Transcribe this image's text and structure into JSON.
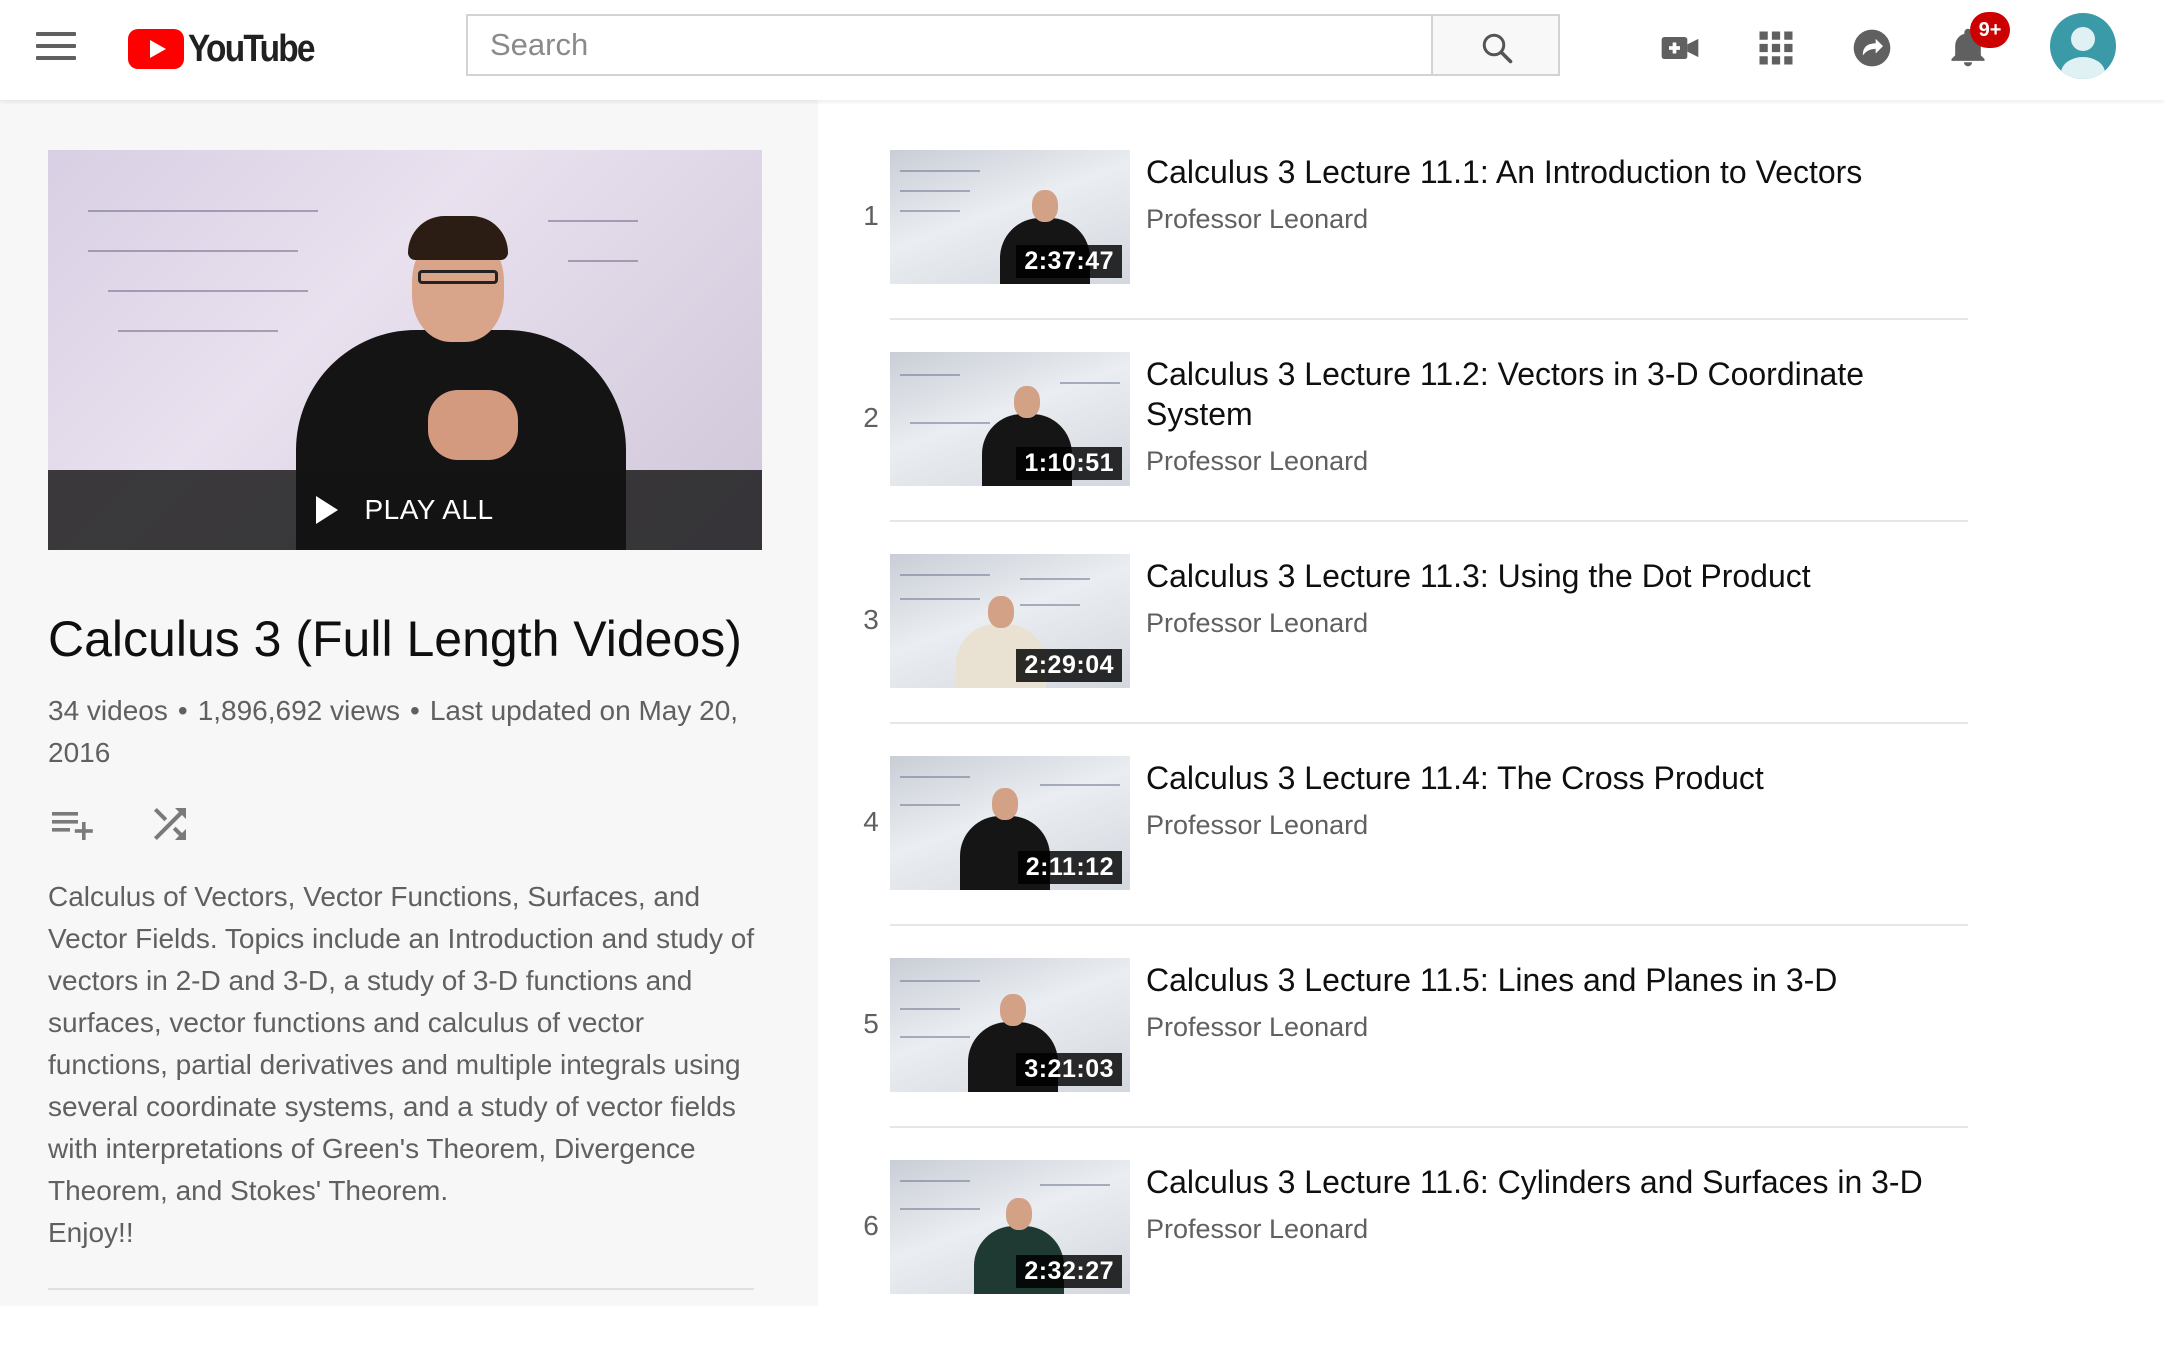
{
  "header": {
    "logo_text": "YouTube",
    "search": {
      "placeholder": "Search",
      "value": ""
    },
    "notification_count": "9+",
    "icons": [
      "menu-icon",
      "video-camera-icon",
      "apps-grid-icon",
      "share-arrow-icon",
      "bell-icon",
      "avatar"
    ]
  },
  "playlist": {
    "play_all_label": "PLAY ALL",
    "title": "Calculus 3 (Full Length Videos)",
    "video_count": "34 videos",
    "views": "1,896,692 views",
    "updated": "Last updated on May 20, 2016",
    "description": "Calculus of Vectors, Vector Functions, Surfaces, and Vector Fields.  Topics include an Introduction and study of vectors in 2-D and 3-D, a study of 3-D functions and surfaces, vector functions and calculus of vector functions, partial derivatives and multiple integrals using several coordinate systems, and a study of vector fields with interpretations of Green's Theorem, Divergence Theorem, and Stokes' Theorem.",
    "enjoy": "Enjoy!!",
    "actions": [
      "add-to-queue-icon",
      "shuffle-icon"
    ]
  },
  "videos": [
    {
      "index": "1",
      "title": "Calculus 3 Lecture 11.1: An Introduction to Vectors",
      "channel": "Professor Leonard",
      "duration": "2:37:47"
    },
    {
      "index": "2",
      "title": "Calculus 3 Lecture 11.2: Vectors in 3-D Coordinate System",
      "channel": "Professor Leonard",
      "duration": "1:10:51"
    },
    {
      "index": "3",
      "title": "Calculus 3 Lecture 11.3: Using the Dot Product",
      "channel": "Professor Leonard",
      "duration": "2:29:04"
    },
    {
      "index": "4",
      "title": "Calculus 3 Lecture 11.4: The Cross Product",
      "channel": "Professor Leonard",
      "duration": "2:11:12"
    },
    {
      "index": "5",
      "title": "Calculus 3 Lecture 11.5: Lines and Planes in 3-D",
      "channel": "Professor Leonard",
      "duration": "3:21:03"
    },
    {
      "index": "6",
      "title": "Calculus 3 Lecture 11.6: Cylinders and Surfaces in 3-D",
      "channel": "Professor Leonard",
      "duration": "2:32:27"
    }
  ],
  "colors": {
    "brand_red": "#ff0000",
    "badge_red": "#cc0000",
    "avatar_teal": "#3a9aa7"
  }
}
